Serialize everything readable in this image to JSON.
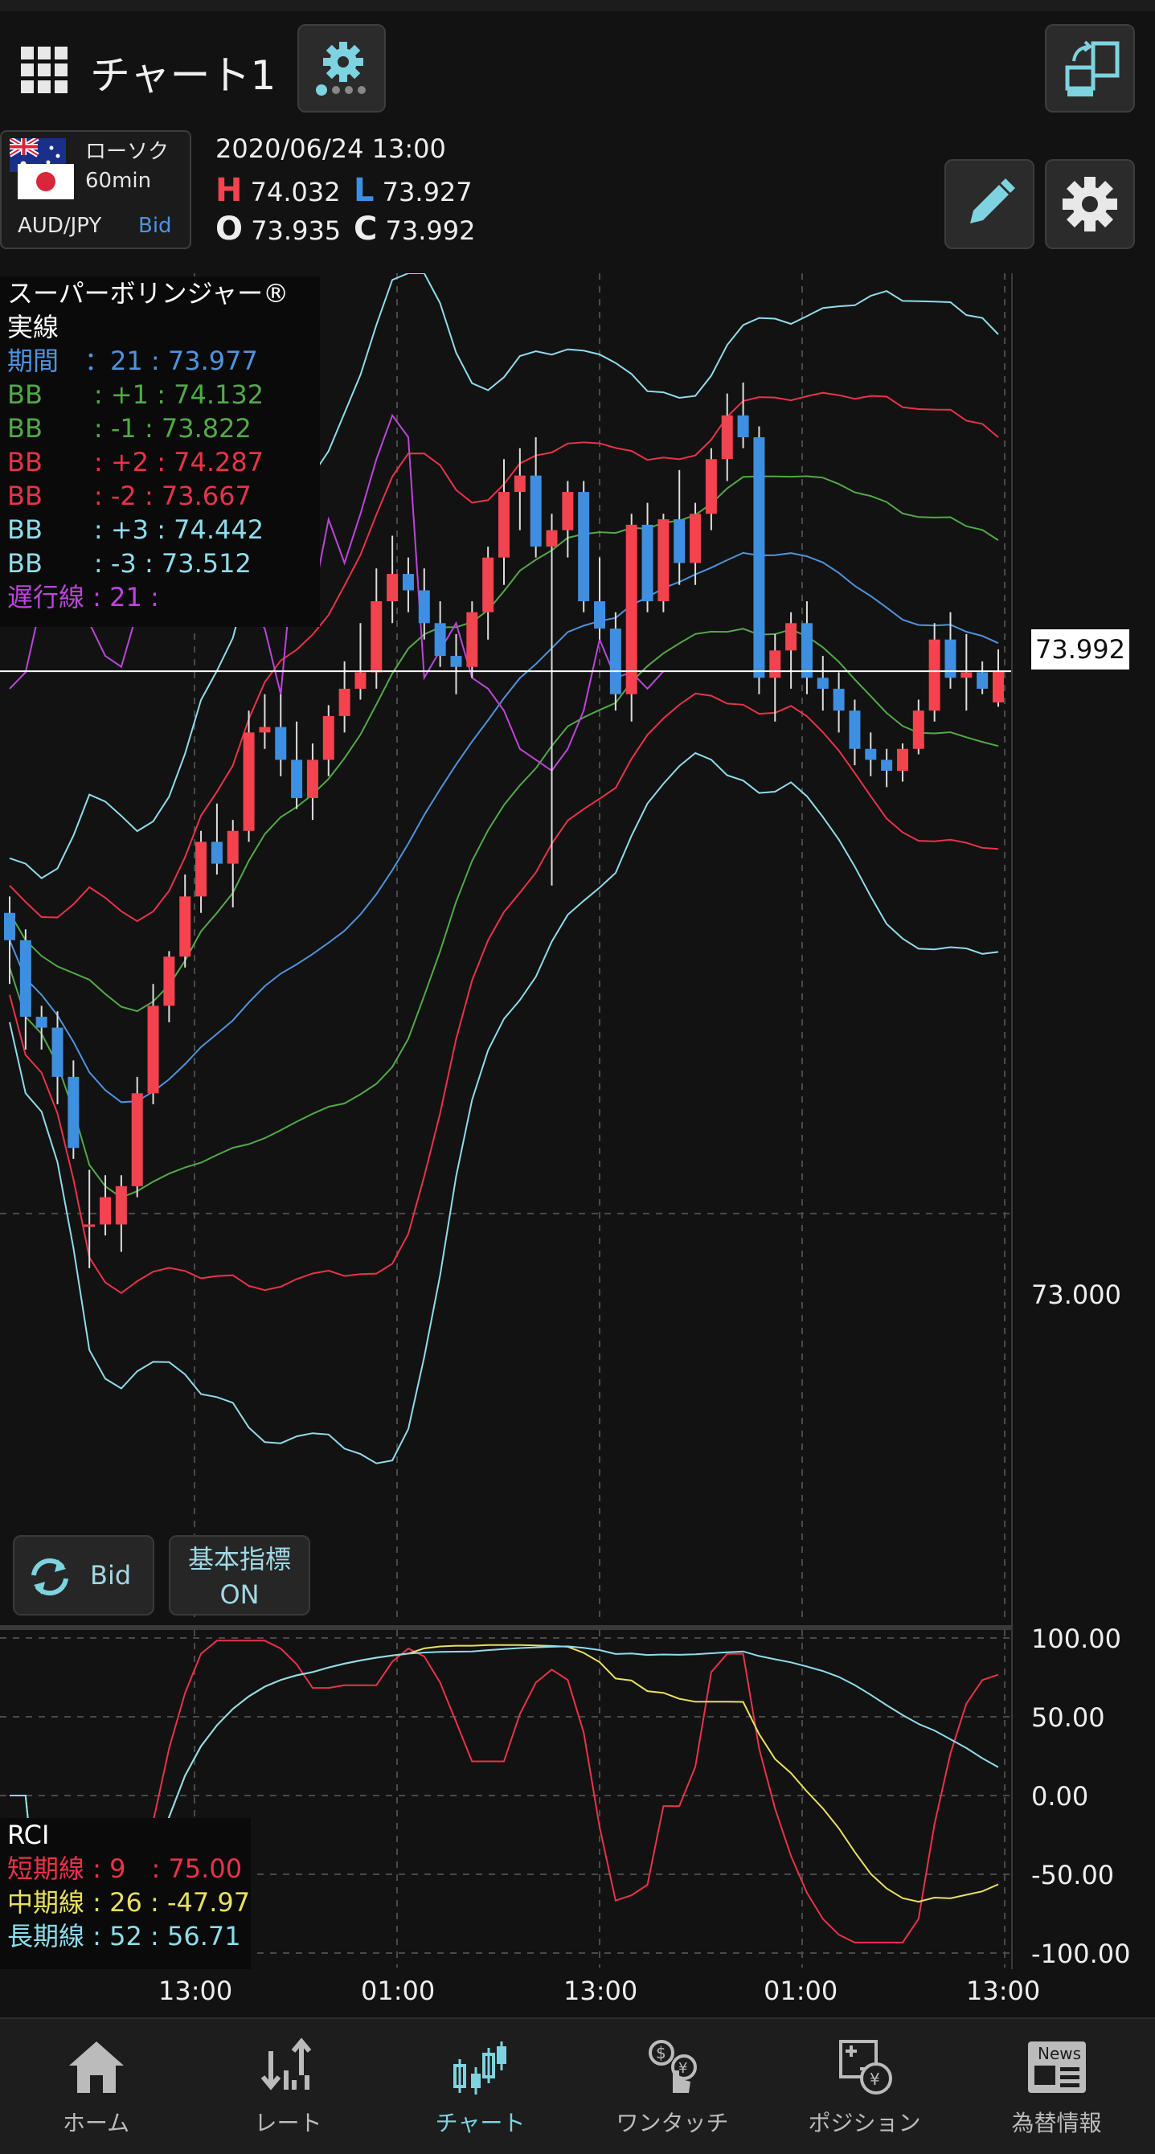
{
  "header": {
    "title": "チャート1"
  },
  "symbol": {
    "chart_type": "ローソク",
    "timeframe": "60min",
    "pair": "AUD/JPY",
    "price_side": "Bid"
  },
  "quote": {
    "datetime": "2020/06/24 13:00",
    "high_label": "H",
    "high": "74.032",
    "low_label": "L",
    "low": "73.927",
    "open_label": "O",
    "open": "73.935",
    "close_label": "C",
    "close": "73.992"
  },
  "legend": {
    "title": "スーパーボリンジャー®",
    "subtitle": "実線",
    "rows": [
      {
        "text": "期間　：21 : 73.977",
        "color": "#4f93dd"
      },
      {
        "text": "BB　　: +1 : 74.132",
        "color": "#52a948"
      },
      {
        "text": "BB　　: -1 : 73.822",
        "color": "#52a948"
      },
      {
        "text": "BB　　: +2 : 74.287",
        "color": "#e8334a"
      },
      {
        "text": "BB　　: -2 : 73.667",
        "color": "#e8334a"
      },
      {
        "text": "BB　　: +3 : 74.442",
        "color": "#8fdcea"
      },
      {
        "text": "BB　　: -3 : 73.512",
        "color": "#8fdcea"
      },
      {
        "text": "遅行線 : 21 :",
        "color": "#bb46d9"
      }
    ]
  },
  "price_axis": {
    "current_price": "73.992",
    "level_label": "73.000"
  },
  "buttons": {
    "bid_label": "Bid",
    "basic_label_1": "基本指標",
    "basic_label_2": "ON"
  },
  "rci": {
    "title": "RCI",
    "rows": [
      {
        "text": "短期線 : 9　: 75.00",
        "color": "#e8334a"
      },
      {
        "text": "中期線 : 26 : -47.97",
        "color": "#e8e060"
      },
      {
        "text": "長期線 : 52 : 56.71",
        "color": "#8fdcea"
      }
    ],
    "axis": [
      "100.00",
      "50.00",
      "0.00",
      "-50.00",
      "-100.00"
    ]
  },
  "time_axis": [
    "13:00",
    "01:00",
    "13:00",
    "01:00",
    "13:00"
  ],
  "nav": [
    {
      "label": "ホーム",
      "icon": "home-icon"
    },
    {
      "label": "レート",
      "icon": "rate-icon"
    },
    {
      "label": "チャート",
      "icon": "chart-icon",
      "active": true
    },
    {
      "label": "ワンタッチ",
      "icon": "one-touch-icon"
    },
    {
      "label": "ポジション",
      "icon": "position-icon"
    },
    {
      "label": "為替情報",
      "icon": "news-icon",
      "badge": "News"
    }
  ],
  "colors": {
    "up": "#f2434e",
    "down": "#3e8fe0",
    "accent": "#7ed3e0",
    "background": "#121212",
    "grid": "#555555"
  },
  "chart_data": {
    "type": "candlestick",
    "timeframe": "60min",
    "price_tick": "73.000",
    "current_price": 73.992,
    "candles_ohlc": [
      [
        73.55,
        73.58,
        73.42,
        73.5
      ],
      [
        73.5,
        73.52,
        73.3,
        73.36
      ],
      [
        73.36,
        73.38,
        73.3,
        73.34
      ],
      [
        73.34,
        73.37,
        73.2,
        73.25
      ],
      [
        73.25,
        73.28,
        73.1,
        73.12
      ],
      [
        72.98,
        73.08,
        72.9,
        72.98
      ],
      [
        72.98,
        73.07,
        72.96,
        73.03
      ],
      [
        72.98,
        73.07,
        72.93,
        73.05
      ],
      [
        73.05,
        73.25,
        73.03,
        73.22
      ],
      [
        73.22,
        73.42,
        73.2,
        73.38
      ],
      [
        73.38,
        73.48,
        73.35,
        73.47
      ],
      [
        73.47,
        73.62,
        73.45,
        73.58
      ],
      [
        73.58,
        73.7,
        73.55,
        73.68
      ],
      [
        73.68,
        73.75,
        73.62,
        73.64
      ],
      [
        73.64,
        73.72,
        73.56,
        73.7
      ],
      [
        73.7,
        73.92,
        73.68,
        73.88
      ],
      [
        73.88,
        73.95,
        73.85,
        73.89
      ],
      [
        73.89,
        73.95,
        73.8,
        73.83
      ],
      [
        73.83,
        73.9,
        73.74,
        73.76
      ],
      [
        73.76,
        73.86,
        73.72,
        73.83
      ],
      [
        73.83,
        73.93,
        73.8,
        73.91
      ],
      [
        73.91,
        74.01,
        73.88,
        73.96
      ],
      [
        73.96,
        74.08,
        73.94,
        73.99
      ],
      [
        73.99,
        74.18,
        73.96,
        74.12
      ],
      [
        74.12,
        74.24,
        74.08,
        74.17
      ],
      [
        74.17,
        74.2,
        74.1,
        74.14
      ],
      [
        74.14,
        74.18,
        74.05,
        74.08
      ],
      [
        74.08,
        74.12,
        74.0,
        74.02
      ],
      [
        74.02,
        74.06,
        73.95,
        74.0
      ],
      [
        74.0,
        74.12,
        73.98,
        74.1
      ],
      [
        74.1,
        74.22,
        74.05,
        74.2
      ],
      [
        74.2,
        74.38,
        74.15,
        74.32
      ],
      [
        74.32,
        74.4,
        74.25,
        74.35
      ],
      [
        74.35,
        74.42,
        74.2,
        74.22
      ],
      [
        74.22,
        74.28,
        73.6,
        74.25
      ],
      [
        74.25,
        74.34,
        74.2,
        74.32
      ],
      [
        74.32,
        74.34,
        74.1,
        74.12
      ],
      [
        74.12,
        74.2,
        74.05,
        74.07
      ],
      [
        74.07,
        74.1,
        73.92,
        73.95
      ],
      [
        73.95,
        74.28,
        73.9,
        74.26
      ],
      [
        74.26,
        74.3,
        74.1,
        74.12
      ],
      [
        74.12,
        74.28,
        74.1,
        74.27
      ],
      [
        74.27,
        74.36,
        74.15,
        74.19
      ],
      [
        74.19,
        74.3,
        74.15,
        74.28
      ],
      [
        74.28,
        74.4,
        74.25,
        74.38
      ],
      [
        74.38,
        74.5,
        74.34,
        74.46
      ],
      [
        74.46,
        74.52,
        74.4,
        74.42
      ],
      [
        74.42,
        74.44,
        73.95,
        73.98
      ],
      [
        73.98,
        74.06,
        73.9,
        74.03
      ],
      [
        74.03,
        74.1,
        73.96,
        74.08
      ],
      [
        74.08,
        74.12,
        73.95,
        73.98
      ],
      [
        73.98,
        74.02,
        73.92,
        73.96
      ],
      [
        73.96,
        73.99,
        73.88,
        73.92
      ],
      [
        73.92,
        73.94,
        73.82,
        73.85
      ],
      [
        73.85,
        73.88,
        73.8,
        73.83
      ],
      [
        73.83,
        73.85,
        73.78,
        73.81
      ],
      [
        73.81,
        73.86,
        73.79,
        73.85
      ],
      [
        73.85,
        73.94,
        73.84,
        73.92
      ],
      [
        73.92,
        74.08,
        73.9,
        74.05
      ],
      [
        74.05,
        74.1,
        73.96,
        73.98
      ],
      [
        73.98,
        74.06,
        73.92,
        73.99
      ],
      [
        73.99,
        74.01,
        73.95,
        73.96
      ],
      [
        73.935,
        74.032,
        73.927,
        73.992
      ]
    ]
  }
}
